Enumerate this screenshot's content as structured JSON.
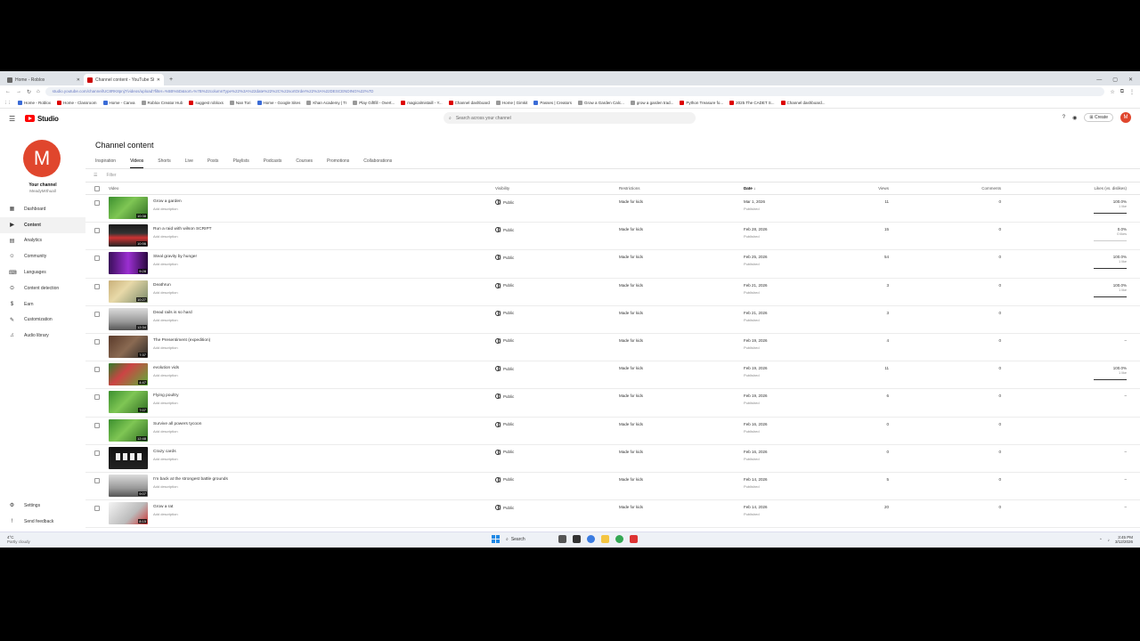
{
  "browser": {
    "tabs": [
      {
        "label": "Home - Roblox",
        "active": false
      },
      {
        "label": "Channel content - YouTube St",
        "active": true
      }
    ],
    "new_tab": "+",
    "url": "studio.youtube.com/channel/UC8RK8pnj7/videos/upload?filter=%5B%5D&sort=%7B%22columnType%22%3A%22date%22%2C%22sortOrder%22%3A%22DESCENDING%22%7D",
    "bookmarks": [
      "Home - Roblox",
      "Home - Classroom",
      "Home - Canva",
      "Roblox Creator Hub",
      "suggest robloxs",
      "Nan Tori",
      "Home - Google Sites",
      "Khan Academy | Tr",
      "Play Giftfill - Overt...",
      "magicalmistaill - Y...",
      "Channel dashboard",
      "Home | Gimkit",
      "Passes | Creators",
      "Grow a Garden Calc...",
      "grow a garden trad...",
      "Python Treasure fo...",
      "2025 The CADET S...",
      "Channel dashboard..."
    ]
  },
  "header": {
    "logo_text": "Studio",
    "search_placeholder": "Search across your channel",
    "create_label": "Create",
    "avatar_letter": "M"
  },
  "sidebar": {
    "avatar_letter": "M",
    "channel_label": "Your channel",
    "channel_handle": "MeadyMrthuall",
    "items": [
      {
        "label": "Dashboard",
        "icon": "dashboard-icon",
        "glyph": "▦",
        "active": false
      },
      {
        "label": "Content",
        "icon": "content-icon",
        "glyph": "▶",
        "active": true
      },
      {
        "label": "Analytics",
        "icon": "analytics-icon",
        "glyph": "▤",
        "active": false
      },
      {
        "label": "Community",
        "icon": "community-icon",
        "glyph": "☺",
        "active": false
      },
      {
        "label": "Languages",
        "icon": "languages-icon",
        "glyph": "⌨",
        "active": false
      },
      {
        "label": "Content detection",
        "icon": "content-detection-icon",
        "glyph": "⊙",
        "active": false
      },
      {
        "label": "Earn",
        "icon": "earn-icon",
        "glyph": "$",
        "active": false
      },
      {
        "label": "Customization",
        "icon": "customization-icon",
        "glyph": "✎",
        "active": false
      },
      {
        "label": "Audio library",
        "icon": "audio-library-icon",
        "glyph": "♫",
        "active": false
      }
    ],
    "bottom": [
      {
        "label": "Settings",
        "icon": "settings-icon",
        "glyph": "⚙"
      },
      {
        "label": "Send feedback",
        "icon": "feedback-icon",
        "glyph": "!"
      }
    ]
  },
  "main": {
    "title": "Channel content",
    "tabs": [
      "Inspiration",
      "Videos",
      "Shorts",
      "Live",
      "Posts",
      "Playlists",
      "Podcasts",
      "Courses",
      "Promotions",
      "Collaborations"
    ],
    "active_tab": "Videos",
    "filter_label": "Filter",
    "columns": {
      "video": "Video",
      "visibility": "Visibility",
      "restrictions": "Restrictions",
      "date": "Date",
      "views": "Views",
      "comments": "Comments",
      "likes": "Likes (vs. dislikes)"
    },
    "rows": [
      {
        "title": "Grow a garden",
        "desc": "Add description",
        "duration": "10:38",
        "visibility": "Public",
        "restrictions": "Made for kids",
        "date": "Mar 1, 2026",
        "status": "Published",
        "views": "11",
        "comments": "0",
        "likes": "100.0%",
        "likes_sub": "1 like",
        "like_pct": 100,
        "thumb": "green"
      },
      {
        "title": "Run a raid with wilson SCRIPT",
        "desc": "Add description",
        "duration": "10:56",
        "visibility": "Public",
        "restrictions": "Made for kids",
        "date": "Feb 28, 2026",
        "status": "Published",
        "views": "15",
        "comments": "0",
        "likes": "0.0%",
        "likes_sub": "0 likes",
        "like_pct": 0,
        "thumb": "dark"
      },
      {
        "title": "Steal gravity by hunger",
        "desc": "Add description",
        "duration": "9:28",
        "visibility": "Public",
        "restrictions": "Made for kids",
        "date": "Feb 25, 2026",
        "status": "Published",
        "views": "54",
        "comments": "0",
        "likes": "100.0%",
        "likes_sub": "1 like",
        "like_pct": 100,
        "thumb": "purple"
      },
      {
        "title": "Deathrun",
        "desc": "Add description",
        "duration": "10:27",
        "visibility": "Public",
        "restrictions": "Made for kids",
        "date": "Feb 21, 2026",
        "status": "Published",
        "views": "3",
        "comments": "0",
        "likes": "100.0%",
        "likes_sub": "1 like",
        "like_pct": 100,
        "thumb": "yellow"
      },
      {
        "title": "Dead rails is so hard",
        "desc": "Add description",
        "duration": "12:34",
        "visibility": "Public",
        "restrictions": "Made for kids",
        "date": "Feb 21, 2026",
        "status": "Published",
        "views": "3",
        "comments": "0",
        "likes": "",
        "likes_sub": "",
        "like_pct": null,
        "thumb": "grey"
      },
      {
        "title": "The Presentiment (expedition)",
        "desc": "Add description",
        "duration": "7:37",
        "visibility": "Public",
        "restrictions": "Made for kids",
        "date": "Feb 19, 2026",
        "status": "Published",
        "views": "4",
        "comments": "0",
        "likes": "–",
        "likes_sub": "",
        "like_pct": null,
        "thumb": "brown"
      },
      {
        "title": "evolution vids",
        "desc": "Add description",
        "duration": "4:47",
        "visibility": "Public",
        "restrictions": "Made for kids",
        "date": "Feb 19, 2026",
        "status": "Published",
        "views": "11",
        "comments": "0",
        "likes": "100.0%",
        "likes_sub": "1 like",
        "like_pct": 100,
        "thumb": "mixed"
      },
      {
        "title": "Flying poultry",
        "desc": "Add description",
        "duration": "7:07",
        "visibility": "Public",
        "restrictions": "Made for kids",
        "date": "Feb 19, 2026",
        "status": "Published",
        "views": "6",
        "comments": "0",
        "likes": "–",
        "likes_sub": "",
        "like_pct": null,
        "thumb": "green"
      },
      {
        "title": "Survive all powers tycoon",
        "desc": "Add description",
        "duration": "12:48",
        "visibility": "Public",
        "restrictions": "Made for kids",
        "date": "Feb 16, 2026",
        "status": "Published",
        "views": "0",
        "comments": "0",
        "likes": "",
        "likes_sub": "",
        "like_pct": null,
        "thumb": "green"
      },
      {
        "title": "Crazy cards",
        "desc": "Add description",
        "duration": "",
        "visibility": "Public",
        "restrictions": "Made for kids",
        "date": "Feb 16, 2026",
        "status": "Published",
        "views": "0",
        "comments": "0",
        "likes": "–",
        "likes_sub": "",
        "like_pct": null,
        "thumb": "black"
      },
      {
        "title": "I'm back at the strongest battle grounds",
        "desc": "Add description",
        "duration": "9:07",
        "visibility": "Public",
        "restrictions": "Made for kids",
        "date": "Feb 14, 2026",
        "status": "Published",
        "views": "5",
        "comments": "0",
        "likes": "–",
        "likes_sub": "",
        "like_pct": null,
        "thumb": "grey"
      },
      {
        "title": "Grow a rat",
        "desc": "Add description",
        "duration": "8:15",
        "visibility": "Public",
        "restrictions": "Made for kids",
        "date": "Feb 14, 2026",
        "status": "Published",
        "views": "20",
        "comments": "0",
        "likes": "–",
        "likes_sub": "",
        "like_pct": null,
        "thumb": "white"
      }
    ]
  },
  "taskbar": {
    "weather_temp": "4°C",
    "weather_desc": "Partly cloudy",
    "search_label": "Search",
    "time": "3:45 PM",
    "date": "3/12/2026"
  },
  "colors": {
    "accent": "#065fd4",
    "brand": "#ff0000",
    "avatar": "#e0462d"
  }
}
